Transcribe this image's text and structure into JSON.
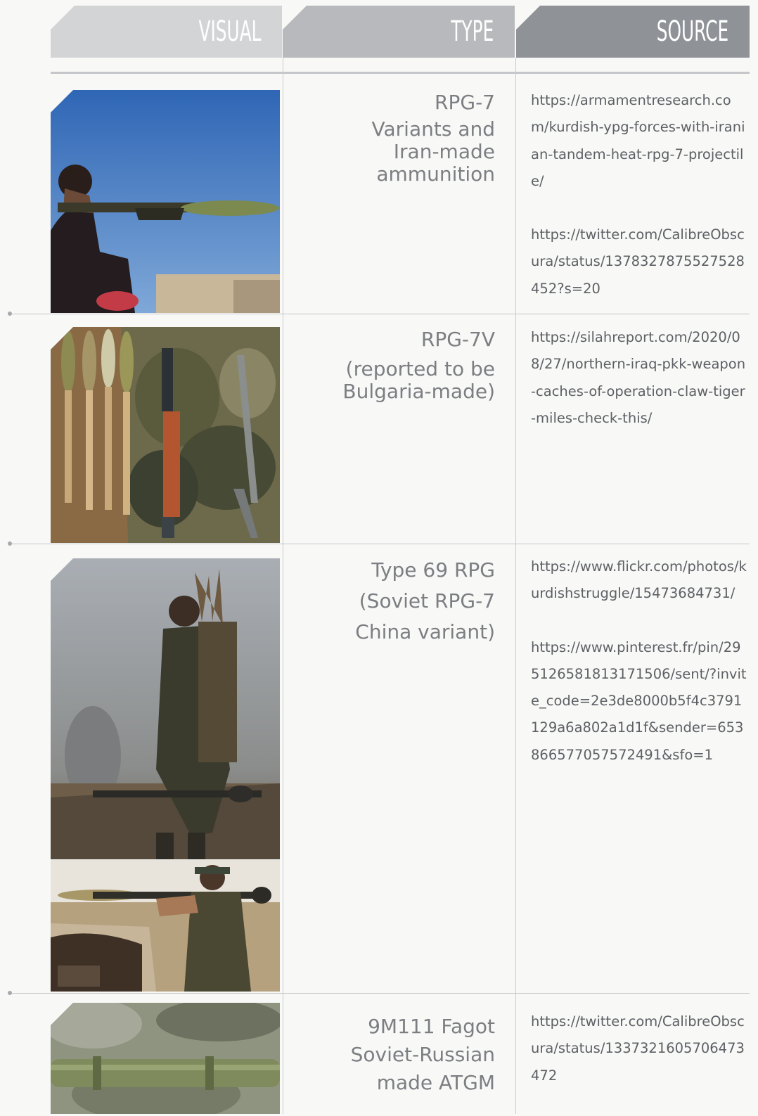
{
  "header": {
    "visual": "VISUAL",
    "type": "TYPE",
    "source": "SOURCE"
  },
  "rows": [
    {
      "type_lines": [
        "RPG-7",
        "Variants and",
        "Iran-made",
        "ammunition"
      ],
      "sources": [
        "https://armamentresearch.com/kurdish-ypg-forces-with-iranian-tandem-heat-rpg-7-projectile/",
        "https://twitter.com/CalibreObscura/status/1378327875527528452?s=20"
      ]
    },
    {
      "type_lines": [
        "RPG-7V",
        "(reported to be",
        "Bulgaria-made)"
      ],
      "sources": [
        "https://silahreport.com/2020/08/27/northern-iraq-pkk-weapon-caches-of-operation-claw-tiger-miles-check-this/"
      ]
    },
    {
      "type_lines": [
        "Type 69 RPG",
        "(Soviet RPG-7",
        "China variant)"
      ],
      "sources": [
        "https://www.flickr.com/photos/kurdishstruggle/15473684731/",
        "https://www.pinterest.fr/pin/295126581813171506/sent/?invite_code=2e3de8000b5f4c3791129a6a802a1d1f&sender=653866577057572491&sfo=1"
      ]
    },
    {
      "type_lines": [
        "9M111 Fagot",
        "Soviet-Russian",
        "made ATGM"
      ],
      "sources": [
        "https://twitter.com/CalibreObscura/status/1337321605706473472"
      ]
    }
  ],
  "colors": {
    "header_visual": "#d2d4d6",
    "header_type": "#b7b9bc",
    "header_source": "#8f9296",
    "type_text": "#7c7e82",
    "source_text": "#5d6064"
  }
}
